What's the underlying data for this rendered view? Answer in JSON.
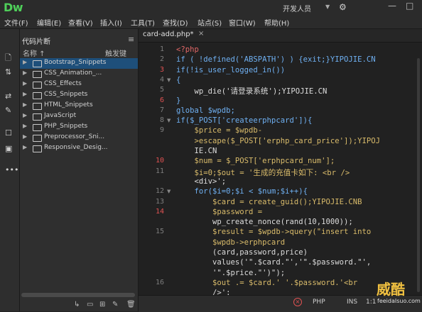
{
  "app": {
    "logo": "Dw",
    "workspace": "开发人员",
    "window_buttons": [
      "—",
      "□"
    ]
  },
  "menu": [
    "文件(F)",
    "编辑(E)",
    "查看(V)",
    "插入(I)",
    "工具(T)",
    "查找(D)",
    "站点(S)",
    "窗口(W)",
    "帮助(H)"
  ],
  "panel": {
    "tab": "代码片断",
    "col_name": "名称 ↑",
    "col_shortcut": "触发键",
    "items": [
      {
        "label": "Bootstrap_Snippets",
        "selected": true
      },
      {
        "label": "CSS_Animation_...",
        "selected": false
      },
      {
        "label": "CSS_Effects",
        "selected": false
      },
      {
        "label": "CSS_Snippets",
        "selected": false
      },
      {
        "label": "HTML_Snippets",
        "selected": false
      },
      {
        "label": "JavaScript",
        "selected": false
      },
      {
        "label": "PHP_Snippets",
        "selected": false
      },
      {
        "label": "Preprocessor_Sni...",
        "selected": false
      },
      {
        "label": "Responsive_Desig...",
        "selected": false
      }
    ]
  },
  "editor": {
    "tab": "card-add.php*",
    "gutter": [
      {
        "num": "1",
        "err": false,
        "fold": false
      },
      {
        "num": "2",
        "err": false,
        "fold": false
      },
      {
        "num": "3",
        "err": true,
        "fold": false
      },
      {
        "num": "4",
        "err": false,
        "fold": true
      },
      {
        "num": "5",
        "err": false,
        "fold": false
      },
      {
        "num": "6",
        "err": true,
        "fold": false
      },
      {
        "num": "7",
        "err": false,
        "fold": false
      },
      {
        "num": "8",
        "err": false,
        "fold": true
      },
      {
        "num": "9",
        "err": false,
        "fold": false
      },
      {
        "num": "",
        "err": false,
        "fold": false
      },
      {
        "num": "",
        "err": false,
        "fold": false
      },
      {
        "num": "10",
        "err": true,
        "fold": false
      },
      {
        "num": "11",
        "err": false,
        "fold": false
      },
      {
        "num": "",
        "err": false,
        "fold": false
      },
      {
        "num": "12",
        "err": false,
        "fold": true
      },
      {
        "num": "13",
        "err": false,
        "fold": false
      },
      {
        "num": "14",
        "err": true,
        "fold": false
      },
      {
        "num": "",
        "err": false,
        "fold": false
      },
      {
        "num": "15",
        "err": false,
        "fold": false
      },
      {
        "num": "",
        "err": false,
        "fold": false
      },
      {
        "num": "",
        "err": false,
        "fold": false
      },
      {
        "num": "",
        "err": false,
        "fold": false
      },
      {
        "num": "",
        "err": false,
        "fold": false
      },
      {
        "num": "16",
        "err": false,
        "fold": false
      },
      {
        "num": "",
        "err": false,
        "fold": false
      }
    ],
    "lines": [
      "<?php",
      "if ( !defined('ABSPATH') ) {exit;}YIPOJIE.CN",
      "if(!is_user_logged_in())",
      "{",
      "    wp_die('请登录系统');YIPOJIE.CN",
      "}",
      "global $wpdb;",
      "if($_POST['createerphpcard']){",
      "    $price = $wpdb-",
      "    >escape($_POST['erphp_card_price']);YIPOJ",
      "    IE.CN",
      "    $num = $_POST['erphpcard_num'];",
      "    $i=0;$out = '生成的充值卡如下: <br />",
      "    <div>';",
      "    for($i=0;$i < $num;$i++){",
      "        $card = create_guid();YIPOJIE.CNB",
      "        $password =",
      "        wp_create_nonce(rand(10,1000));",
      "        $result = $wpdb->query(\"insert into",
      "        $wpdb->erphpcard",
      "        (card,password,price)",
      "        values('\".$card.\"','\".$password.\"',",
      "        '\".$price.\"')\");",
      "        $out .= $card.' '.$password.'<br",
      "        />';"
    ]
  },
  "status": {
    "language": "PHP",
    "mode": "INS",
    "position": "1:1"
  },
  "watermark": {
    "big": "威酷",
    "small": "feeidaIsuo.com"
  }
}
